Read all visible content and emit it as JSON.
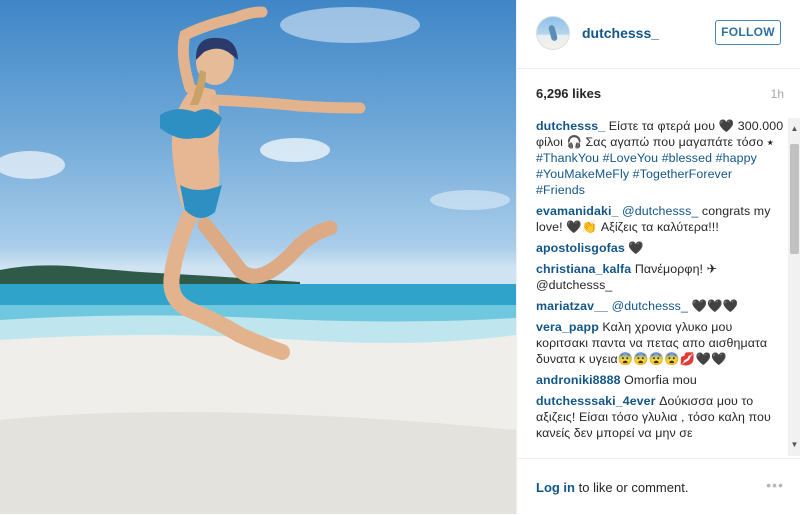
{
  "post": {
    "username": "dutchesss_",
    "follow_label": "FOLLOW",
    "likes": "6,296 likes",
    "time_ago": "1h",
    "login_link": "Log in",
    "login_rest": " to like or comment.",
    "more_label": "•••"
  },
  "caption": {
    "user": "dutchesss_",
    "text": " Είστε τα φτερά μου 🖤 300.000 φίλοι 🎧 Σας αγαπώ που μαγαπάτε τόσο ⭑ ",
    "tags": "#ThankYou #LoveYou #blessed #happy #YouMakeMeFly #TogetherForever #Friends"
  },
  "comments": [
    {
      "user": "evamanidaki_",
      "mention": " @dutchesss_",
      "text": " congrats my love! 🖤👏 Αξίζεις τα καλύτερα!!!"
    },
    {
      "user": "apostolisgofas",
      "mention": "",
      "text": " 🖤"
    },
    {
      "user": "christiana_kalfa",
      "mention": "",
      "text": " Πανέμορφη! ✈@dutchesss_"
    },
    {
      "user": "mariatzav__",
      "mention": " @dutchesss_",
      "text": " 🖤🖤🖤"
    },
    {
      "user": "vera_papp",
      "mention": "",
      "text": " Καλη χρονια γλυκο μου κοριτσακι παντα να πετας απο αισθηματα δυνατα κ υγεια😨😨😨😨💋🖤🖤"
    },
    {
      "user": "androniki8888",
      "mention": "",
      "text": " Omorfia mou"
    },
    {
      "user": "dutchesssaki_4ever",
      "mention": "",
      "text": " Δούκισσα μου το αξιζεις! Είσαι τόσο γλυλια , τόσο καλη που κανείς δεν μπορεί να μην σε"
    }
  ],
  "colors": {
    "link": "#125688",
    "follow_border": "#4a86b8",
    "text": "#262626",
    "muted": "#a5a7aa"
  },
  "icons": {
    "scroll_up": "▲",
    "scroll_down": "▼"
  }
}
